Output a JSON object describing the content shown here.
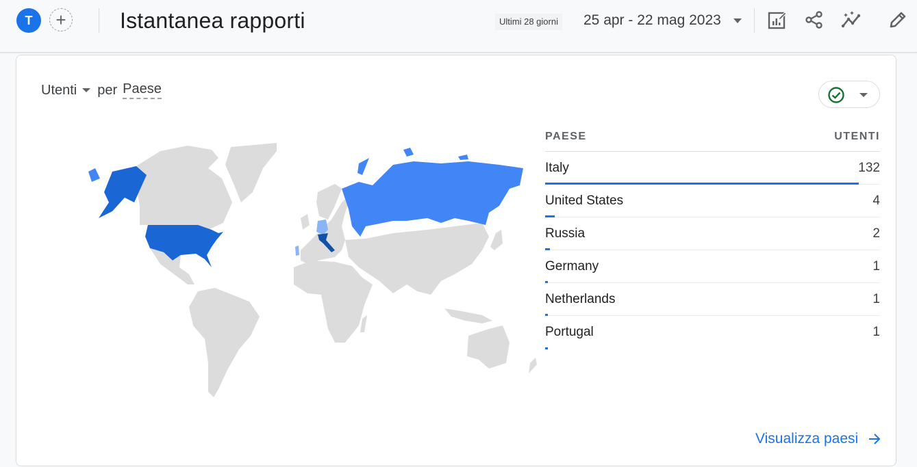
{
  "header": {
    "avatar_letter": "T",
    "add_label": "+",
    "title": "Istantanea rapporti",
    "range_chip": "Ultimi 28 giorni",
    "date_range": "25 apr - 22 mag 2023",
    "icons": [
      "customize-report-icon",
      "share-icon",
      "insights-icon",
      "edit-icon"
    ]
  },
  "card": {
    "metric": "Utenti",
    "connector": "per",
    "dimension": "Paese",
    "status_icon": "check-circle-icon",
    "table": {
      "headers": [
        "PAESE",
        "UTENTI"
      ],
      "rows": [
        {
          "country": "Italy",
          "users": "132",
          "share": 1.0
        },
        {
          "country": "United States",
          "users": "4",
          "share": 0.03
        },
        {
          "country": "Russia",
          "users": "2",
          "share": 0.015
        },
        {
          "country": "Germany",
          "users": "1",
          "share": 0.008
        },
        {
          "country": "Netherlands",
          "users": "1",
          "share": 0.008
        },
        {
          "country": "Portugal",
          "users": "1",
          "share": 0.008
        }
      ]
    },
    "map_colors": {
      "base": "#dcdcdc",
      "italy": "#1450a3",
      "united_states": "#1a66d4",
      "russia": "#4285f4",
      "low": "#8ab4f8"
    },
    "view_link": "Visualizza paesi"
  }
}
